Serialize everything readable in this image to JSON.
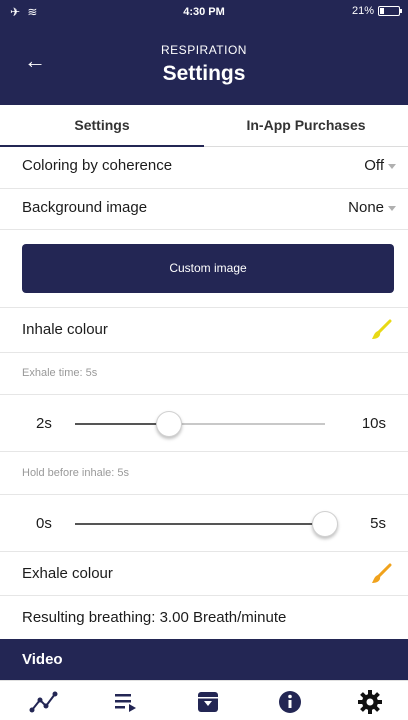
{
  "status_bar": {
    "left_icons": "✈ ≋",
    "time": "4:30 PM",
    "battery": "21%",
    "battery_level": 0.21
  },
  "header": {
    "back_label": "←",
    "subtitle": "RESPIRATION",
    "title": "Settings"
  },
  "tabs": [
    {
      "label": "Settings",
      "active": true
    },
    {
      "label": "In-App Purchases",
      "active": false
    }
  ],
  "settings": {
    "coloring": {
      "label": "Coloring by coherence",
      "value": "Off"
    },
    "background": {
      "label": "Background image",
      "value": "None"
    },
    "custom_image_button": "Custom image",
    "inhale_colour": {
      "label": "Inhale colour",
      "color": "#e8d915"
    },
    "exhale_time": {
      "label": "Exhale time: 5s",
      "min": "2s",
      "max": "10s",
      "value": 5,
      "range": [
        2,
        10
      ]
    },
    "hold_before_inhale": {
      "label": "Hold before inhale: 5s",
      "min": "0s",
      "max": "5s",
      "value": 5,
      "range": [
        0,
        5
      ]
    },
    "exhale_colour": {
      "label": "Exhale colour",
      "color": "#f0a21c"
    },
    "resulting": "Resulting breathing: 3.00 Breath/minute"
  },
  "video_section": {
    "label": "Video"
  },
  "bottom_nav": [
    {
      "name": "chart-icon"
    },
    {
      "name": "playlist-icon"
    },
    {
      "name": "archive-icon"
    },
    {
      "name": "info-icon"
    },
    {
      "name": "gear-icon",
      "active": true
    }
  ],
  "colors": {
    "primary": "#232654"
  }
}
